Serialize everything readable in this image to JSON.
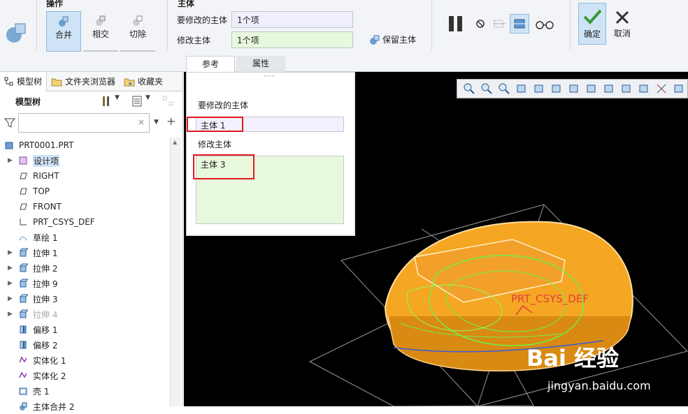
{
  "ribbon": {
    "ops_title": "操作",
    "main_title": "主体",
    "ops": [
      {
        "label": "合并"
      },
      {
        "label": "相交"
      },
      {
        "label": "切除"
      }
    ],
    "field1_label": "要修改的主体",
    "field1_value": "1个项",
    "field2_label": "修改主体",
    "field2_value": "1个项",
    "keep_label": "保留主体",
    "tabs": [
      "参考",
      "属性"
    ],
    "ok_label": "确定",
    "cancel_label": "取消"
  },
  "left_panel": {
    "tabs": [
      "模型树",
      "文件夹浏览器",
      "收藏夹"
    ],
    "tree_title": "模型树",
    "filter_placeholder": "",
    "root": "PRT0001.PRT",
    "items": [
      {
        "label": "设计项",
        "icon": "design-items-icon",
        "expand": true,
        "hl": true
      },
      {
        "label": "RIGHT",
        "icon": "datum-plane-icon",
        "expand": false
      },
      {
        "label": "TOP",
        "icon": "datum-plane-icon",
        "expand": false
      },
      {
        "label": "FRONT",
        "icon": "datum-plane-icon",
        "expand": false
      },
      {
        "label": "PRT_CSYS_DEF",
        "icon": "csys-icon",
        "expand": false
      },
      {
        "label": "草绘 1",
        "icon": "sketch-icon",
        "expand": false
      },
      {
        "label": "拉伸 1",
        "icon": "extrude-icon",
        "expand": true
      },
      {
        "label": "拉伸 2",
        "icon": "extrude-icon",
        "expand": true
      },
      {
        "label": "拉伸 9",
        "icon": "extrude-icon",
        "expand": true
      },
      {
        "label": "拉伸 3",
        "icon": "extrude-icon",
        "expand": true
      },
      {
        "label": "拉伸 4",
        "icon": "extrude-icon",
        "expand": true,
        "gray": true
      },
      {
        "label": "偏移 1",
        "icon": "offset-icon",
        "expand": false
      },
      {
        "label": "偏移 2",
        "icon": "offset-icon",
        "expand": false
      },
      {
        "label": "实体化 1",
        "icon": "solidify-icon",
        "expand": false
      },
      {
        "label": "实体化 2",
        "icon": "solidify-icon",
        "expand": false
      },
      {
        "label": "壳 1",
        "icon": "shell-icon",
        "expand": false
      },
      {
        "label": "主体合并 2",
        "icon": "merge-icon",
        "expand": false
      }
    ]
  },
  "ref_panel": {
    "label1": "要修改的主体",
    "value1": "主体 1",
    "label2": "修改主体",
    "value2": "主体 3"
  },
  "viewport": {
    "csys_label": "PRT_CSYS_DEF",
    "watermark_brand": "Bai 经验",
    "watermark_url": "jingyan.baidu.com"
  },
  "colors": {
    "accent": "#cfe3f7",
    "model_orange": "#f5a623",
    "highlight_red": "#e0191e",
    "green_field": "#e8f8dc"
  }
}
